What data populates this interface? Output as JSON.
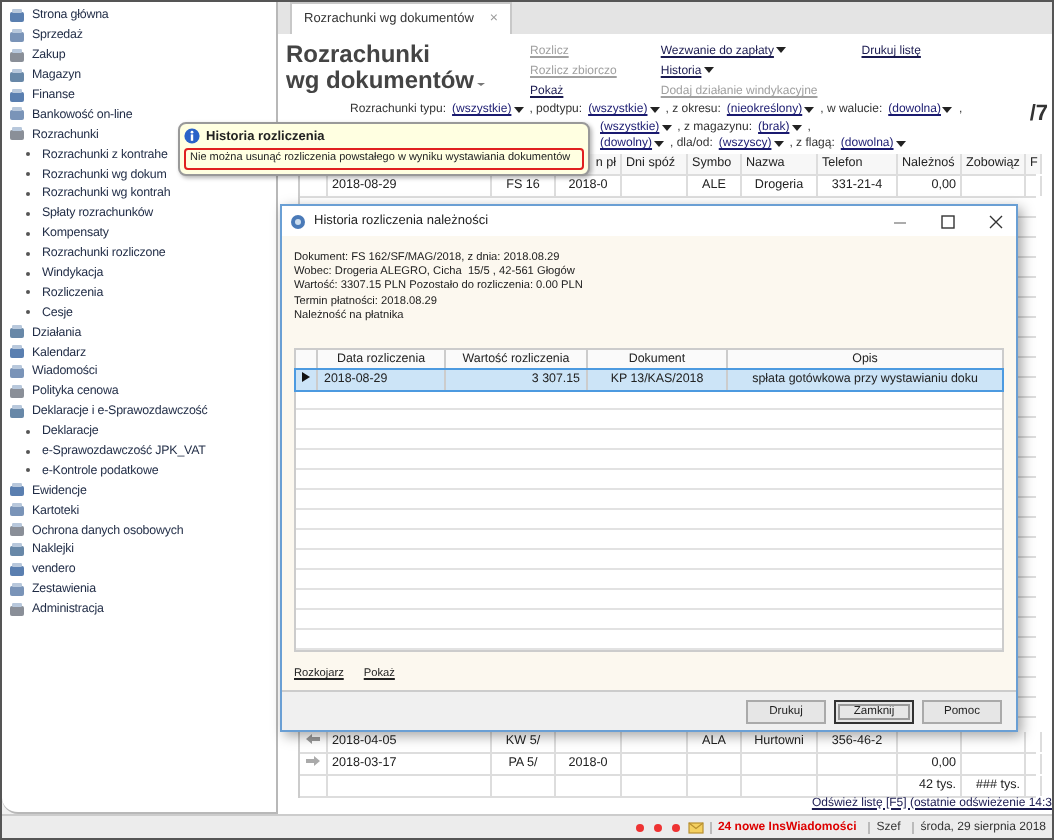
{
  "sidebar": {
    "items": [
      {
        "label": "Strona główna"
      },
      {
        "label": "Sprzedaż"
      },
      {
        "label": "Zakup"
      },
      {
        "label": "Magazyn"
      },
      {
        "label": "Finanse"
      },
      {
        "label": "Bankowość on-line"
      },
      {
        "label": "Rozrachunki",
        "children": [
          {
            "label": "Rozrachunki z kontrahe"
          },
          {
            "label": "Rozrachunki wg dokum"
          },
          {
            "label": "Rozrachunki wg kontrah"
          },
          {
            "label": "Spłaty rozrachunków"
          },
          {
            "label": "Kompensaty"
          },
          {
            "label": "Rozrachunki rozliczone"
          },
          {
            "label": "Windykacja"
          },
          {
            "label": "Rozliczenia"
          },
          {
            "label": "Cesje"
          }
        ]
      },
      {
        "label": "Działania"
      },
      {
        "label": "Kalendarz"
      },
      {
        "label": "Wiadomości"
      },
      {
        "label": "Polityka cenowa"
      },
      {
        "label": "Deklaracje i e-Sprawozdawczość",
        "children": [
          {
            "label": "Deklaracje"
          },
          {
            "label": "e-Sprawozdawczość JPK_VAT"
          },
          {
            "label": "e-Kontrole podatkowe"
          }
        ]
      },
      {
        "label": "Ewidencje"
      },
      {
        "label": "Kartoteki"
      },
      {
        "label": "Ochrona danych osobowych"
      },
      {
        "label": "Naklejki"
      },
      {
        "label": "vendero"
      },
      {
        "label": "Zestawienia"
      },
      {
        "label": "Administracja"
      }
    ]
  },
  "tabs": [
    {
      "label": "Rozrachunki wg dokumentów",
      "close": "×",
      "selected": true
    }
  ],
  "header": {
    "title_lines": [
      "Rozrachunki",
      "wg dokumentów"
    ],
    "link_columns": [
      [
        {
          "label": "Rozlicz",
          "disabled": true
        },
        {
          "label": "Rozlicz zbiorczo",
          "disabled": true
        },
        {
          "label": "Pokaż",
          "disabled": false
        }
      ],
      [
        {
          "label": "Wezwanie do zapłaty",
          "menu": true,
          "disabled": false
        },
        {
          "label": "Historia",
          "menu": true,
          "disabled": false
        },
        {
          "label": "Dodaj działanie windykacyjne",
          "disabled": true
        }
      ],
      [
        {
          "label": "Drukuj listę",
          "disabled": false
        }
      ]
    ],
    "page_count": "/7"
  },
  "filters": [
    [
      {
        "kind": "label",
        "text": "Rozrachunki typu:"
      },
      {
        "kind": "dropdown",
        "text": "(wszystkie)"
      },
      {
        "kind": "label",
        "text": ", podtypu:"
      },
      {
        "kind": "dropdown",
        "text": "(wszystkie)"
      },
      {
        "kind": "label",
        "text": ", z okresu:"
      },
      {
        "kind": "dropdown",
        "text": "(nieokreślony)"
      },
      {
        "kind": "label",
        "text": ", w walucie:"
      },
      {
        "kind": "dropdown",
        "text": "(dowolna)"
      },
      {
        "kind": "label",
        "text": ","
      }
    ],
    [
      {
        "kind": "dropdown",
        "text": "(wszystkie)"
      },
      {
        "kind": "label",
        "text": ", z magazynu:"
      },
      {
        "kind": "dropdown",
        "text": "(brak)"
      },
      {
        "kind": "label",
        "text": ","
      }
    ],
    [
      {
        "kind": "dropdown",
        "text": "(dowolny)"
      },
      {
        "kind": "label",
        "text": ", dla/od:"
      },
      {
        "kind": "dropdown",
        "text": "(wszyscy)"
      },
      {
        "kind": "label",
        "text": ", z flagą:"
      },
      {
        "kind": "dropdown",
        "text": "(dowolna)"
      }
    ]
  ],
  "table": {
    "columns": [
      "n pł",
      "Dni spóź",
      "Symbo",
      "Nazwa",
      "Telefon",
      "Należnoś",
      "Zobowiąz",
      "F"
    ],
    "top_rows": [
      {
        "cells": [
          "2018-08-29",
          "FS 16",
          "2018-0",
          "",
          "ALE",
          "Drogeria",
          "331-21-4",
          "0,00",
          "",
          ""
        ]
      }
    ],
    "bottom_rows": [
      {
        "kind": "outgoing",
        "cells": [
          "2018-04-05",
          "KW 5/",
          "",
          "",
          "ALA",
          "Hurtowni",
          "356-46-2",
          "",
          "",
          ""
        ]
      },
      {
        "kind": "incoming",
        "cells": [
          "2018-03-17",
          "PA 5/",
          "2018-0",
          "",
          "",
          "",
          "",
          "0,00",
          "",
          ""
        ]
      }
    ],
    "totals": [
      "42 tys.",
      "### tys."
    ]
  },
  "refresh_link": "Odśwież listę [F5] (ostatnie odświeżenie 14:3",
  "status_bar": {
    "messages": "24 nowe InsWiadomości",
    "user": "Szef",
    "date": "środa, 29 sierpnia 2018"
  },
  "tooltip": {
    "title": "Historia rozliczenia",
    "message": "Nie można usunąć rozliczenia powstałego w wyniku wystawiania dokumentów"
  },
  "dialog": {
    "title": "Historia rozliczenia należności",
    "info": [
      "Dokument: FS 162/SF/MAG/2018, z dnia: 2018.08.29",
      "Wobec: Drogeria ALEGRO, Cicha  15/5 , 42-561 Głogów",
      "Wartość: 3307.15 PLN Pozostało do rozliczenia: 0.00 PLN",
      "Termin płatności: 2018.08.29",
      "Należność na płatnika"
    ],
    "columns": [
      "Data rozliczenia",
      "Wartość rozliczenia",
      "Dokument",
      "Opis"
    ],
    "rows": [
      {
        "selected": true,
        "cells": [
          "2018-08-29",
          "3 307.15",
          "KP 13/KAS/2018",
          "spłata gotówkowa przy wystawianiu doku"
        ]
      }
    ],
    "links": [
      "Rozkojarz",
      "Pokaż"
    ],
    "buttons": [
      {
        "label": "Drukuj",
        "default": false
      },
      {
        "label": "Zamknij",
        "default": true
      },
      {
        "label": "Pomoc",
        "default": false
      }
    ]
  }
}
